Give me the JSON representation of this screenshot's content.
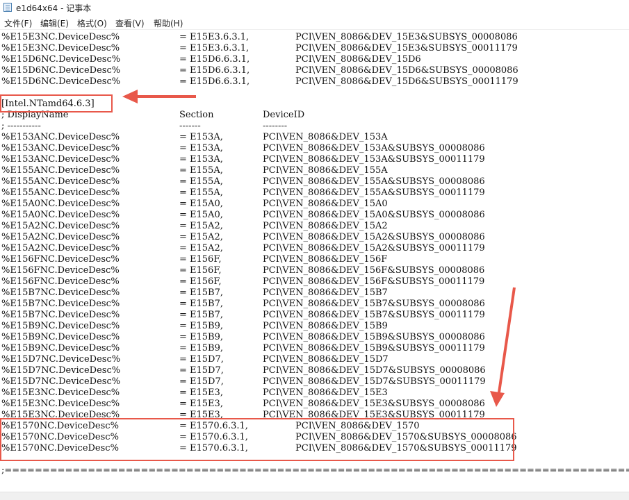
{
  "window": {
    "title": "e1d64x64 - 记事本"
  },
  "menu": [
    "文件(F)",
    "编辑(E)",
    "格式(O)",
    "查看(V)",
    "帮助(H)"
  ],
  "lines": [
    {
      "c": [
        "%E15E3NC.DeviceDesc%",
        "= E15E3.6.3.1,",
        "PCI\\VEN_8086&DEV_15E3&SUBSYS_00008086"
      ],
      "w": 1
    },
    {
      "c": [
        "%E15E3NC.DeviceDesc%",
        "= E15E3.6.3.1,",
        "PCI\\VEN_8086&DEV_15E3&SUBSYS_00011179"
      ],
      "w": 1
    },
    {
      "c": [
        "%E15D6NC.DeviceDesc%",
        "= E15D6.6.3.1,",
        "PCI\\VEN_8086&DEV_15D6"
      ],
      "w": 1
    },
    {
      "c": [
        "%E15D6NC.DeviceDesc%",
        "= E15D6.6.3.1,",
        "PCI\\VEN_8086&DEV_15D6&SUBSYS_00008086"
      ],
      "w": 1
    },
    {
      "c": [
        "%E15D6NC.DeviceDesc%",
        "= E15D6.6.3.1,",
        "PCI\\VEN_8086&DEV_15D6&SUBSYS_00011179"
      ],
      "w": 1
    },
    {
      "c": [
        ""
      ]
    },
    {
      "c": [
        "[Intel.NTamd64.6.3]"
      ]
    },
    {
      "c": [
        "; DisplayName",
        "Section",
        "DeviceID"
      ]
    },
    {
      "c": [
        "; -----------",
        "-------",
        "--------"
      ]
    },
    {
      "c": [
        "%E153ANC.DeviceDesc%",
        "= E153A,",
        "PCI\\VEN_8086&DEV_153A"
      ]
    },
    {
      "c": [
        "%E153ANC.DeviceDesc%",
        "= E153A,",
        "PCI\\VEN_8086&DEV_153A&SUBSYS_00008086"
      ]
    },
    {
      "c": [
        "%E153ANC.DeviceDesc%",
        "= E153A,",
        "PCI\\VEN_8086&DEV_153A&SUBSYS_00011179"
      ]
    },
    {
      "c": [
        "%E155ANC.DeviceDesc%",
        "= E155A,",
        "PCI\\VEN_8086&DEV_155A"
      ]
    },
    {
      "c": [
        "%E155ANC.DeviceDesc%",
        "= E155A,",
        "PCI\\VEN_8086&DEV_155A&SUBSYS_00008086"
      ]
    },
    {
      "c": [
        "%E155ANC.DeviceDesc%",
        "= E155A,",
        "PCI\\VEN_8086&DEV_155A&SUBSYS_00011179"
      ]
    },
    {
      "c": [
        "%E15A0NC.DeviceDesc%",
        "= E15A0,",
        "PCI\\VEN_8086&DEV_15A0"
      ]
    },
    {
      "c": [
        "%E15A0NC.DeviceDesc%",
        "= E15A0,",
        "PCI\\VEN_8086&DEV_15A0&SUBSYS_00008086"
      ]
    },
    {
      "c": [
        "%E15A2NC.DeviceDesc%",
        "= E15A2,",
        "PCI\\VEN_8086&DEV_15A2"
      ]
    },
    {
      "c": [
        "%E15A2NC.DeviceDesc%",
        "= E15A2,",
        "PCI\\VEN_8086&DEV_15A2&SUBSYS_00008086"
      ]
    },
    {
      "c": [
        "%E15A2NC.DeviceDesc%",
        "= E15A2,",
        "PCI\\VEN_8086&DEV_15A2&SUBSYS_00011179"
      ]
    },
    {
      "c": [
        "%E156FNC.DeviceDesc%",
        "= E156F,",
        "PCI\\VEN_8086&DEV_156F"
      ]
    },
    {
      "c": [
        "%E156FNC.DeviceDesc%",
        "= E156F,",
        "PCI\\VEN_8086&DEV_156F&SUBSYS_00008086"
      ]
    },
    {
      "c": [
        "%E156FNC.DeviceDesc%",
        "= E156F,",
        "PCI\\VEN_8086&DEV_156F&SUBSYS_00011179"
      ]
    },
    {
      "c": [
        "%E15B7NC.DeviceDesc%",
        "= E15B7,",
        "PCI\\VEN_8086&DEV_15B7"
      ]
    },
    {
      "c": [
        "%E15B7NC.DeviceDesc%",
        "= E15B7,",
        "PCI\\VEN_8086&DEV_15B7&SUBSYS_00008086"
      ]
    },
    {
      "c": [
        "%E15B7NC.DeviceDesc%",
        "= E15B7,",
        "PCI\\VEN_8086&DEV_15B7&SUBSYS_00011179"
      ]
    },
    {
      "c": [
        "%E15B9NC.DeviceDesc%",
        "= E15B9,",
        "PCI\\VEN_8086&DEV_15B9"
      ]
    },
    {
      "c": [
        "%E15B9NC.DeviceDesc%",
        "= E15B9,",
        "PCI\\VEN_8086&DEV_15B9&SUBSYS_00008086"
      ]
    },
    {
      "c": [
        "%E15B9NC.DeviceDesc%",
        "= E15B9,",
        "PCI\\VEN_8086&DEV_15B9&SUBSYS_00011179"
      ]
    },
    {
      "c": [
        "%E15D7NC.DeviceDesc%",
        "= E15D7,",
        "PCI\\VEN_8086&DEV_15D7"
      ]
    },
    {
      "c": [
        "%E15D7NC.DeviceDesc%",
        "= E15D7,",
        "PCI\\VEN_8086&DEV_15D7&SUBSYS_00008086"
      ]
    },
    {
      "c": [
        "%E15D7NC.DeviceDesc%",
        "= E15D7,",
        "PCI\\VEN_8086&DEV_15D7&SUBSYS_00011179"
      ]
    },
    {
      "c": [
        "%E15E3NC.DeviceDesc%",
        "= E15E3,",
        "PCI\\VEN_8086&DEV_15E3"
      ]
    },
    {
      "c": [
        "%E15E3NC.DeviceDesc%",
        "= E15E3,",
        "PCI\\VEN_8086&DEV_15E3&SUBSYS_00008086"
      ]
    },
    {
      "c": [
        "%E15E3NC.DeviceDesc%",
        "= E15E3,",
        "PCI\\VEN_8086&DEV_15E3&SUBSYS_00011179"
      ]
    },
    {
      "c": [
        "%E1570NC.DeviceDesc%",
        "= E1570.6.3.1,",
        "PCI\\VEN_8086&DEV_1570"
      ],
      "w": 1
    },
    {
      "c": [
        "%E1570NC.DeviceDesc%",
        "= E1570.6.3.1,",
        "PCI\\VEN_8086&DEV_1570&SUBSYS_00008086"
      ],
      "w": 1
    },
    {
      "c": [
        "%E1570NC.DeviceDesc%",
        "= E1570.6.3.1,",
        "PCI\\VEN_8086&DEV_1570&SUBSYS_00011179"
      ],
      "w": 1
    },
    {
      "c": [
        ""
      ]
    },
    {
      "c": [
        ";==================================================================================="
      ]
    }
  ],
  "colors": {
    "annotation": "#e8584a"
  }
}
